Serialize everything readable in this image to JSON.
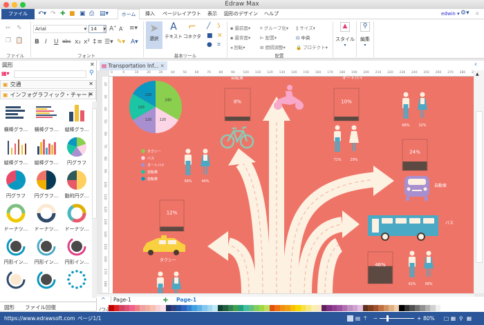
{
  "app": {
    "title": "Edraw Max"
  },
  "menu": {
    "file": "ファイル",
    "tabs": [
      "ホーム",
      "挿入",
      "ページレイアウト",
      "表示",
      "図形のデザイン",
      "ヘルプ"
    ],
    "user": "edwin"
  },
  "ribbon": {
    "groups": {
      "file": "ファイル",
      "font": "フォント",
      "basic_tools": "基本ツール",
      "arrange": "配置"
    },
    "font_name": "Arial",
    "font_size": "14",
    "tools": {
      "select": "選択",
      "text": "テキスト",
      "connector": "コネクタ"
    },
    "arrange_items": [
      "最前面",
      "最背面",
      "回転",
      "グループ化",
      "配置",
      "間隔調整",
      "サイズ",
      "中央",
      "プロテクト"
    ],
    "style": "スタイル",
    "edit": "編集"
  },
  "left_panel": {
    "title": "図形",
    "search_placeholder": "",
    "libraries": [
      "交通",
      "インフォグラフィック・チャート"
    ],
    "shapes": [
      "横棒グラ...",
      "横棒グラ...",
      "縦棒グラ...",
      "縦棒グラ...",
      "縦棒グラ...",
      "円グラフ",
      "円グラフ",
      "円グラフ...",
      "動的円グ...",
      "ドーナツ...",
      "ドーナツ...",
      "ドーナツ...",
      "円形イン...",
      "円形イン...",
      "円形イン...",
      "",
      "",
      ""
    ],
    "bottom_tabs": [
      "図形",
      "ファイル回復"
    ]
  },
  "document_tab": {
    "title": "Transportation Inf..."
  },
  "ruler": {
    "ticks": [
      "0",
      "0",
      "10",
      "20",
      "30",
      "40",
      "50",
      "60",
      "70",
      "80",
      "90",
      "100",
      "110",
      "120",
      "130",
      "140",
      "150",
      "160",
      "170",
      "180",
      "190",
      "200",
      "210",
      "220",
      "230",
      "240",
      "250",
      "260",
      "270",
      "280",
      "290"
    ],
    "vticks": [
      "20",
      "30",
      "40",
      "50",
      "60",
      "70",
      "80",
      "90",
      "100",
      "110",
      "120",
      "130",
      "140",
      "150",
      "160",
      "170",
      "180"
    ]
  },
  "infographic": {
    "pie": [
      {
        "label": "タクシー",
        "value": 240,
        "color": "#8bcf4f"
      },
      {
        "label": "バス",
        "value": 120,
        "color": "#fcd6e6"
      },
      {
        "label": "オートバイ",
        "value": 120,
        "color": "#a88fd0"
      },
      {
        "label": "自転車",
        "value": 120,
        "color": "#1bc6a4"
      },
      {
        "label": "自転車",
        "value": 120,
        "color": "#0a97c0"
      }
    ],
    "boxes": [
      {
        "label": "自転車",
        "pct": "8%",
        "fill": 0.08
      },
      {
        "label": "オートバイ",
        "pct": "10%",
        "fill": 0.1
      },
      {
        "label": "自動車",
        "pct": "24%",
        "fill": 0.24
      },
      {
        "label": "タクシー",
        "pct": "12%",
        "fill": 0.12
      },
      {
        "label": "バス",
        "pct": "46%",
        "fill": 0.46
      }
    ],
    "gender": [
      [
        "56%",
        "44%"
      ],
      [
        "71%",
        "29%"
      ],
      [
        "68%",
        "32%"
      ],
      [
        "42%",
        "58%"
      ]
    ],
    "colors": {
      "bg": "#ef7468",
      "road": "#fdf1e2",
      "box": "#5c4a42",
      "person": "#fdf1e2",
      "accent": "#4ba9c6"
    }
  },
  "pages": {
    "current": "Page-1",
    "tab": "Page-1"
  },
  "palette_label": "ﾉつぶ",
  "status": {
    "url": "https://www.edrawsoft.com",
    "page": "ページ1/1",
    "zoom": "80%"
  }
}
